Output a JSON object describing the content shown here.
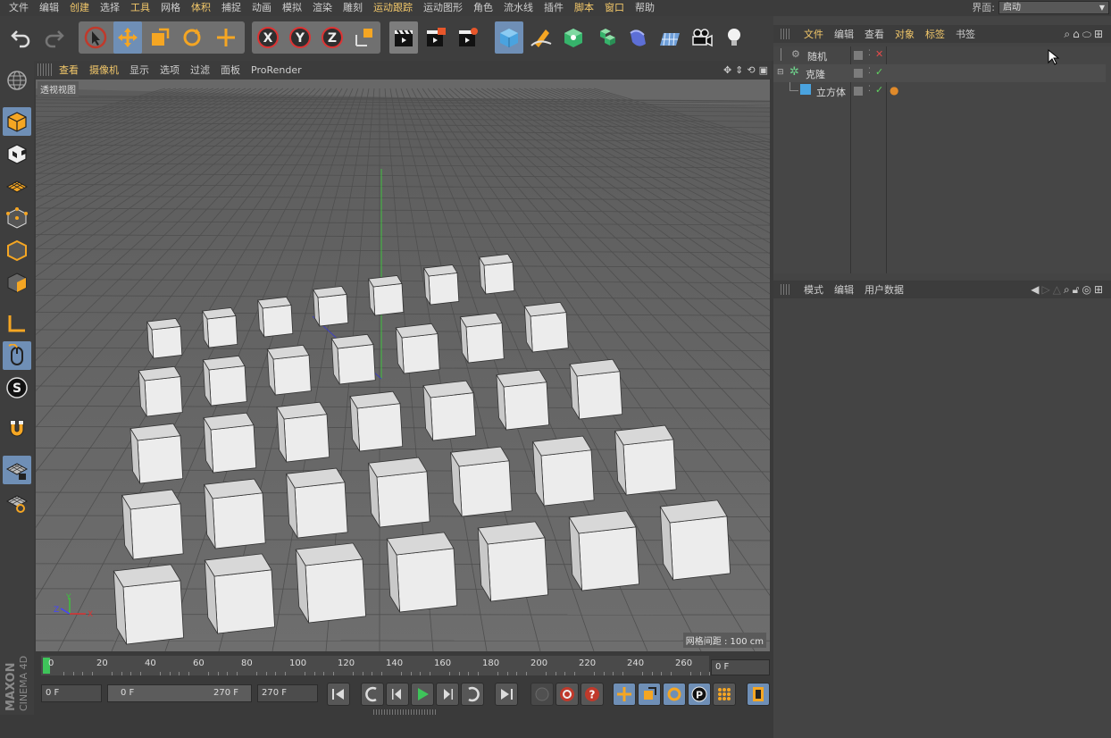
{
  "menubar": {
    "items": [
      {
        "label": "文件",
        "hl": false
      },
      {
        "label": "编辑",
        "hl": false
      },
      {
        "label": "创建",
        "hl": true
      },
      {
        "label": "选择",
        "hl": false
      },
      {
        "label": "工具",
        "hl": true
      },
      {
        "label": "网格",
        "hl": false
      },
      {
        "label": "体积",
        "hl": true
      },
      {
        "label": "捕捉",
        "hl": false
      },
      {
        "label": "动画",
        "hl": false
      },
      {
        "label": "模拟",
        "hl": false
      },
      {
        "label": "渲染",
        "hl": false
      },
      {
        "label": "雕刻",
        "hl": false
      },
      {
        "label": "运动跟踪",
        "hl": true
      },
      {
        "label": "运动图形",
        "hl": false
      },
      {
        "label": "角色",
        "hl": false
      },
      {
        "label": "流水线",
        "hl": false
      },
      {
        "label": "插件",
        "hl": false
      },
      {
        "label": "脚本",
        "hl": true
      },
      {
        "label": "窗口",
        "hl": true
      },
      {
        "label": "帮助",
        "hl": false
      }
    ],
    "layout_label": "界面:",
    "layout_value": "启动"
  },
  "viewport_menu": {
    "items": [
      {
        "label": "查看",
        "hl": true
      },
      {
        "label": "摄像机",
        "hl": true
      },
      {
        "label": "显示",
        "hl": false
      },
      {
        "label": "选项",
        "hl": false
      },
      {
        "label": "过滤",
        "hl": false
      },
      {
        "label": "面板",
        "hl": false
      },
      {
        "label": "ProRender",
        "hl": false
      }
    ]
  },
  "viewport": {
    "title": "透视视图",
    "grid_spacing": "网格间距 : 100 cm",
    "axis_labels": {
      "x": "X",
      "y": "Y",
      "z": "Z"
    }
  },
  "timeline": {
    "ticks": [
      "0",
      "20",
      "40",
      "60",
      "80",
      "100",
      "120",
      "140",
      "160",
      "180",
      "200",
      "220",
      "240",
      "260"
    ],
    "current_frame": "0 F"
  },
  "transport": {
    "start_field": "0 F",
    "range_start": "0 F",
    "range_end": "270 F",
    "end_field": "270 F"
  },
  "object_manager": {
    "menu": [
      {
        "label": "文件",
        "hl": true
      },
      {
        "label": "编辑",
        "hl": false
      },
      {
        "label": "查看",
        "hl": false
      },
      {
        "label": "对象",
        "hl": true
      },
      {
        "label": "标签",
        "hl": true
      },
      {
        "label": "书签",
        "hl": false
      }
    ],
    "objects": [
      {
        "name": "随机",
        "status": "✕",
        "status_color": "#e24b4b"
      },
      {
        "name": "克隆",
        "status": "✓",
        "status_color": "#5fd35f"
      },
      {
        "name": "立方体",
        "status": "✓",
        "status_color": "#5fd35f"
      }
    ]
  },
  "attribute_manager": {
    "menu": [
      {
        "label": "模式",
        "hl": false
      },
      {
        "label": "编辑",
        "hl": false
      },
      {
        "label": "用户数据",
        "hl": false
      }
    ]
  },
  "brand": {
    "line1": "MAXON",
    "line2": "CINEMA 4D"
  },
  "colors": {
    "accent": "#f3c86a",
    "select": "#6f8fb6",
    "viewport": "#6b6b6b"
  }
}
